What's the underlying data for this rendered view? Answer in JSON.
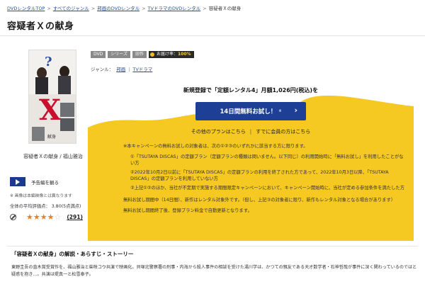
{
  "breadcrumb": [
    {
      "label": "DVDレンタルTOP"
    },
    {
      "label": "すべてのジャンル"
    },
    {
      "label": "邦画のDVDレンタル"
    },
    {
      "label": "TVドラマのDVDレンタル"
    },
    {
      "label": "容疑者Ｘの献身"
    }
  ],
  "page_title": "容疑者Ｘの献身",
  "product": {
    "caption": "容疑者Ｘの献身 / 福山雅治",
    "trailer_label": "予告編を観る",
    "note": "※ 画像は本編映像とは異なります",
    "avg_rating": "全体の平均評価点：  3.80(5点満点)",
    "stars": [
      "★",
      "★",
      "★",
      "★",
      "☆"
    ],
    "review_count": "(291)",
    "icons": {
      "ban": "ban-icon",
      "play": "play-icon"
    }
  },
  "badges": {
    "dvd": "DVD",
    "series": "シリーズ",
    "old": "旧作",
    "delivery_label": "お届け率：",
    "delivery_pct": "100%"
  },
  "genre": {
    "label": "ジャンル：",
    "items": [
      "邦画",
      "TVドラマ"
    ],
    "sep": "|"
  },
  "promo": {
    "headline": "新規登録で「定額レンタル4」月額1,026円(税込)を",
    "cta_label": "14日間無料お試し！",
    "cta_ext": "※",
    "cta_chevron": "›",
    "other_plans": "その他のプランはこちら",
    "divider": "|",
    "member_link": "すでに会員の方はこちら",
    "colors": {
      "accent": "#1d3f96",
      "highlight": "#f6c822"
    }
  },
  "notice": {
    "lead": "※本キャンペーンの無料お試しの対象者は、次の①②③のいずれかに該当する方に限ります。",
    "items": [
      "①「TSUTAYA DISCAS」の定額プラン（定額プランの種類は問いません。以下同じ）の利用開始時に「無料お試し」を利用したことがない方",
      "②2022年10月2日以前に「TSUTAYA DISCAS」の定額プランの利用を終了された方であって、2022年10月3日以降、「TSUTAYA DISCAS」の定額プランを利用していない方",
      "③上記①②のほか、当社が不定期で実施する期間限定キャンペーンにおいて、キャンペーン開始時に、当社が定める参加条件を満たした方"
    ],
    "trial_period": "無料お試し期間中（14日間）、新作はレンタル対象外です。（但し、上記③の対象者に限り、新作もレンタル対象となる場合があります）",
    "after_trial": "無料お試し期間終了後、登録プラン料金で自動更新となります。"
  },
  "story": {
    "title_quoted": "「容疑者Ｘの献身」",
    "title_rest": "の解説・あらすじ・ストーリー",
    "text": "東野圭吾の直木賞受賞作を、福山雅治と柴咲コウ共演で映画化。貝塚北警察署の刑事・内海から殺人事件の相談を受けた湯川学は、かつての親友である天才数学者・石神哲哉が事件に深く関わっているのではと疑惑を抱き…。共演は堤真一と松雪泰子。"
  }
}
